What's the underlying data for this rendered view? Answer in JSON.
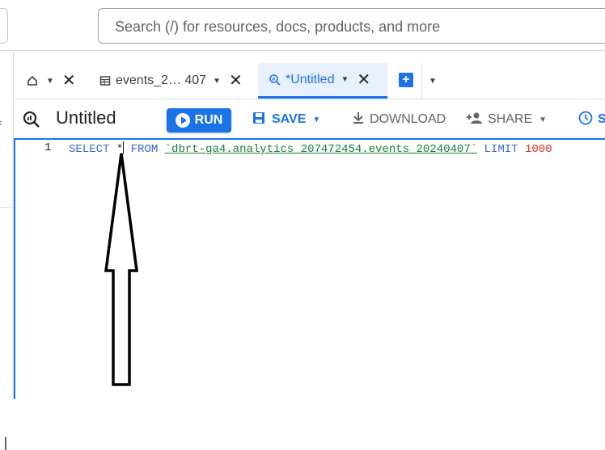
{
  "search": {
    "placeholder": "Search (/) for resources, docs, products, and more"
  },
  "tabs": [
    {
      "label": "",
      "icon": "home-icon"
    },
    {
      "label": "events_2… 407",
      "icon": "table-icon"
    },
    {
      "label": "*Untitled",
      "icon": "query-icon"
    }
  ],
  "toolbar": {
    "title": "Untitled",
    "run_label": "RUN",
    "save_label": "SAVE",
    "download_label": "DOWNLOAD",
    "share_label": "SHARE",
    "schedule_label": "S"
  },
  "editor": {
    "line_number": "1",
    "kw_select": "SELECT",
    "star": " *",
    "kw_from": " FROM ",
    "table_ref": "`dbrt-ga4.analytics_207472454.events_20240407`",
    "kw_limit": " LIMIT ",
    "limit_value": "1000"
  },
  "colors": {
    "accent": "#1a73e8",
    "keyword": "#3367d6",
    "string": "#188038",
    "number": "#d93025"
  }
}
